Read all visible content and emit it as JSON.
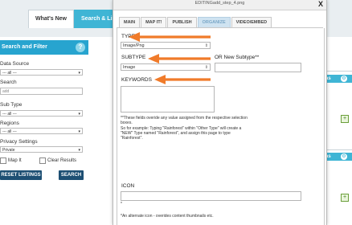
{
  "background": {
    "tabs": [
      {
        "label": "What's New"
      },
      {
        "label": "Search & List V"
      }
    ],
    "sidebar": {
      "header": "Search and Filter",
      "help_icon": "?",
      "data_source_label": "Data Source",
      "data_source_value": "--- all ---",
      "search_label": "Search",
      "search_placeholder": "add",
      "sub_type_label": "Sub Type",
      "sub_type_value": "--- all ---",
      "regions_label": "Regions",
      "regions_value": "--- all ---",
      "privacy_label": "Privacy Settings",
      "privacy_value": "Private",
      "map_it_label": "Map It",
      "clear_results_label": "Clear Results",
      "reset_label": "RESET LISTINGS",
      "search_button": "SEARCH"
    },
    "right_panels": [
      {
        "label": "as"
      },
      {
        "label": "as"
      }
    ],
    "colors": {
      "accent": "#27a4cf",
      "dark_button": "#1d4f73",
      "arrow": "#f07b2a"
    }
  },
  "modal": {
    "title": "EDITINGadd_step_4.png",
    "close_label": "X",
    "tabs": [
      {
        "label": "MAIN"
      },
      {
        "label": "MAP IT!"
      },
      {
        "label": "PUBLISH"
      },
      {
        "label": "ORGANIZE"
      },
      {
        "label": "VIDEO/EMBED"
      }
    ],
    "active_tab": "ORGANIZE",
    "type_label": "TYPE",
    "type_value": "Image/Png",
    "subtype_label": "SUBTYPE",
    "subtype_value": "Image",
    "new_subtype_label": "OR New Subtype**",
    "keywords_label": "KEYWORDS",
    "note_lines": [
      "**These fields overide any value assigned from the respective selection",
      "boxes.",
      "So for example: Typing \"Rainforest\" within \"Other Type\" will create a",
      "\"NEW\" Type named \"Rainforest\", and assign this page to type",
      "\"Rainforest\"."
    ],
    "icon_label": "ICON",
    "icon_asterisk": "*",
    "icon_note": "*An alternate icon - overides content thumbnails etc."
  }
}
